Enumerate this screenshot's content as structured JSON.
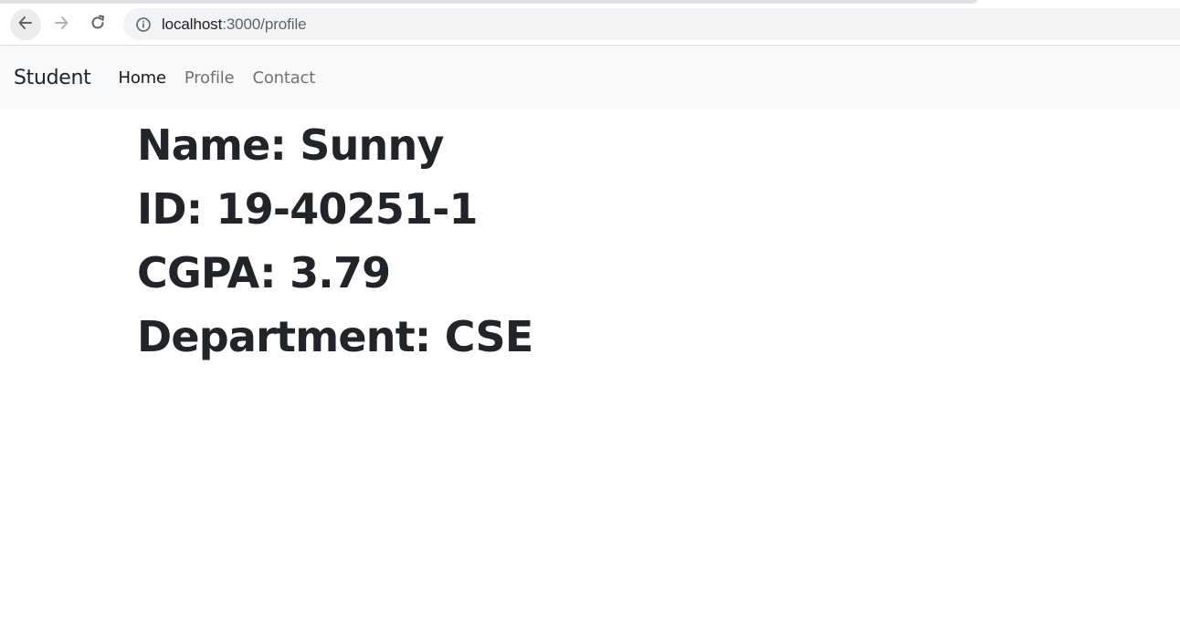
{
  "browser": {
    "url_host": "localhost",
    "url_path": ":3000/profile",
    "icons": {
      "back": "arrow-left-icon",
      "forward": "arrow-right-icon",
      "reload": "reload-icon",
      "info": "info-icon"
    }
  },
  "navbar": {
    "brand": "Student",
    "links": [
      {
        "label": "Home",
        "active": true
      },
      {
        "label": "Profile",
        "active": false
      },
      {
        "label": "Contact",
        "active": false
      }
    ]
  },
  "profile": {
    "name_line": "Name: Sunny",
    "id_line": "ID: 19-40251-1",
    "cgpa_line": "CGPA: 3.79",
    "department_line": "Department: CSE"
  },
  "colors": {
    "navbar_bg": "#f8f9fa",
    "text": "#212529",
    "muted_link": "#8c8c8c"
  }
}
